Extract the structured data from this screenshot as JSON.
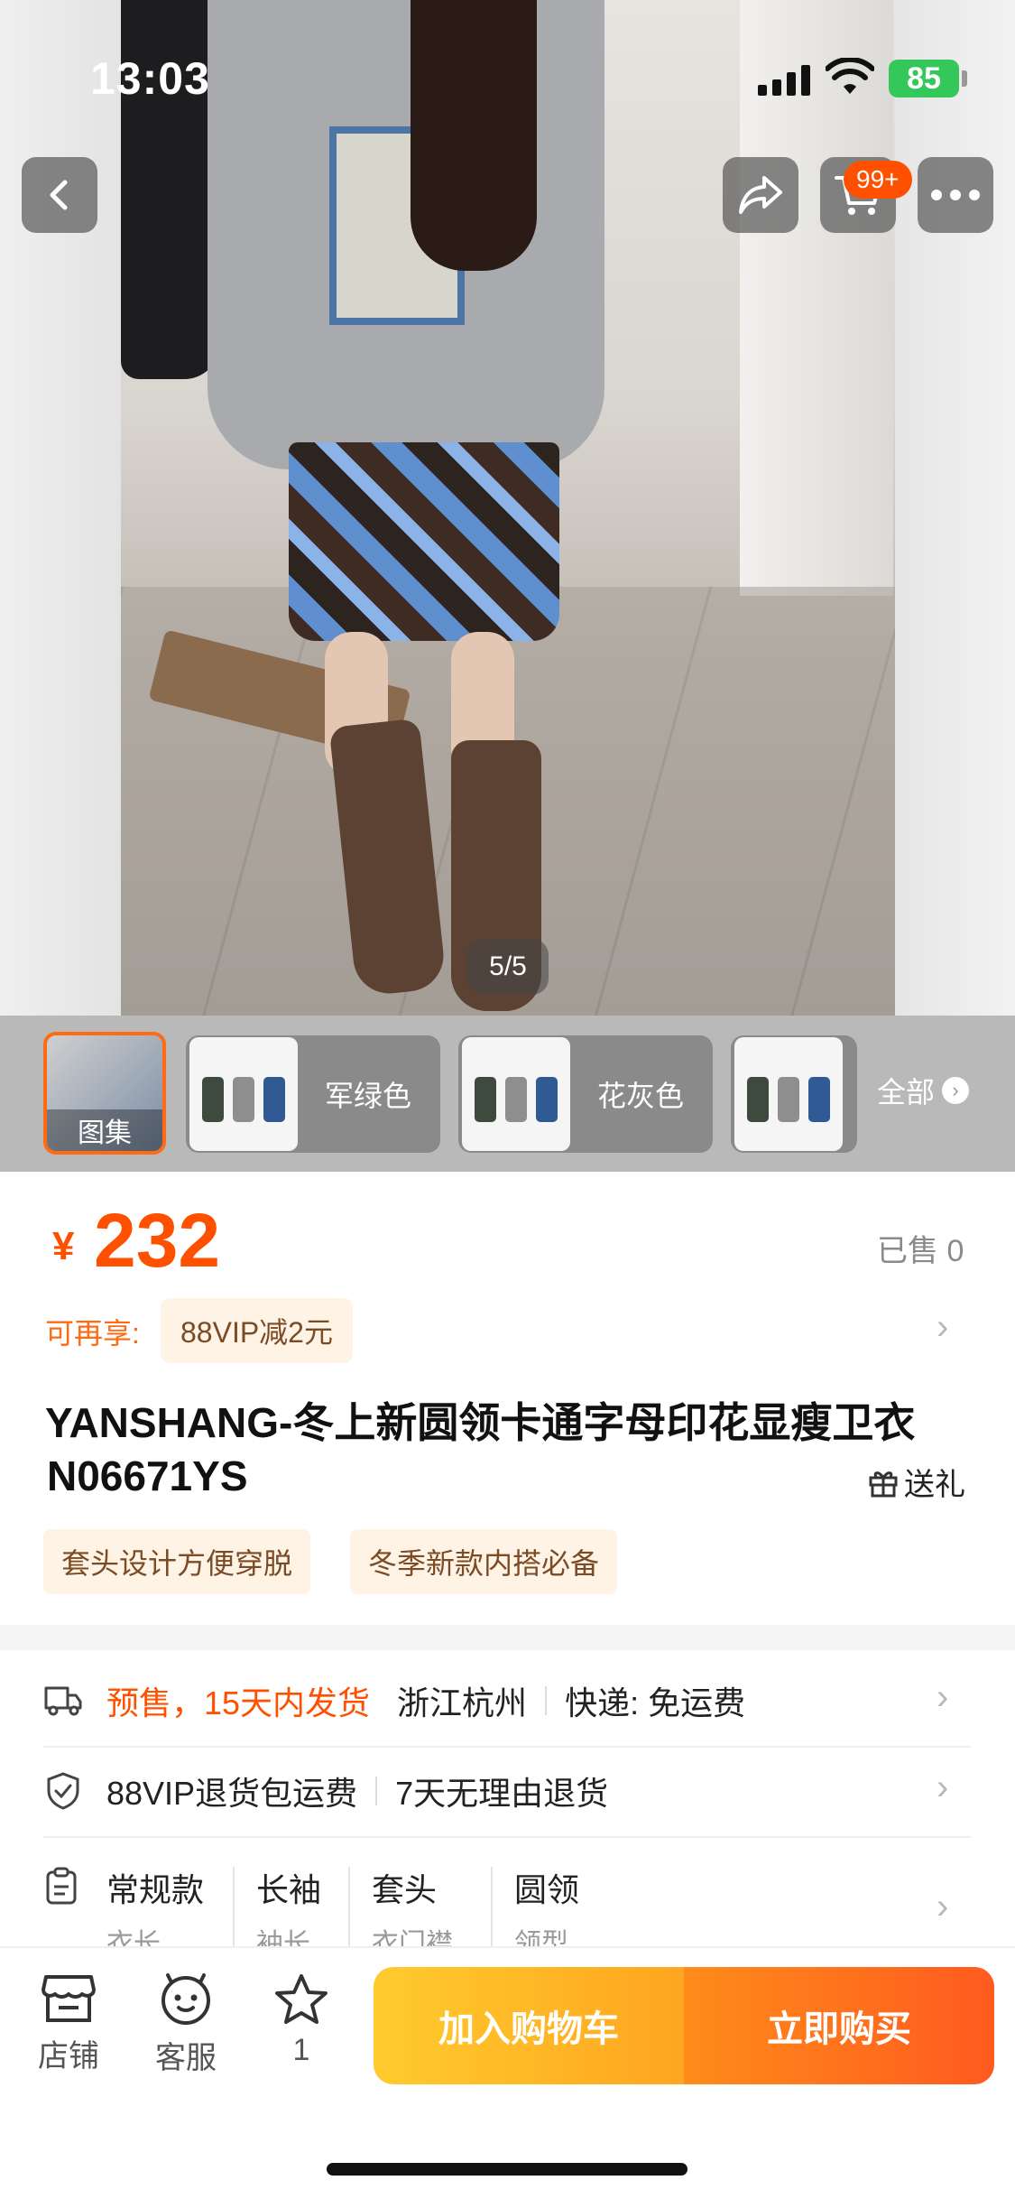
{
  "status_bar": {
    "time": "13:03",
    "battery": "85"
  },
  "top_bar": {
    "cart_badge": "99+"
  },
  "gallery": {
    "pager": "5/5"
  },
  "thumbnails": {
    "gallery_label": "图集",
    "variants": [
      {
        "label": "军绿色"
      },
      {
        "label": "花灰色"
      }
    ],
    "all_label": "全部"
  },
  "price": {
    "currency": "¥",
    "value": "232",
    "sold": "已售 0"
  },
  "promo": {
    "prefix": "可再享:",
    "tag": "88VIP减2元"
  },
  "product": {
    "title_line1": "YANSHANG-冬上新圆领卡通字母印花显瘦卫衣",
    "title_line2": "N06671YS",
    "gift_label": "送礼",
    "tags": [
      "套头设计方便穿脱",
      "冬季新款内搭必备"
    ]
  },
  "shipping": {
    "presale": "预售，15天内发货",
    "origin": "浙江杭州",
    "express": "快递: 免运费"
  },
  "service": {
    "return_shipping": "88VIP退货包运费",
    "no_reason": "7天无理由退货"
  },
  "attributes": [
    {
      "value": "常规款",
      "name": "衣长"
    },
    {
      "value": "长袖",
      "name": "袖长"
    },
    {
      "value": "套头",
      "name": "衣门襟"
    },
    {
      "value": "圆领",
      "name": "领型"
    }
  ],
  "bottom_bar": {
    "shop": "店铺",
    "service": "客服",
    "favorites": "1",
    "add_to_cart": "加入购物车",
    "buy_now": "立即购买"
  },
  "colors": {
    "accent": "#ff5000",
    "tag_bg": "#fff3e6",
    "cart_btn": "#ffb023",
    "buy_btn": "#ff6a1f"
  }
}
